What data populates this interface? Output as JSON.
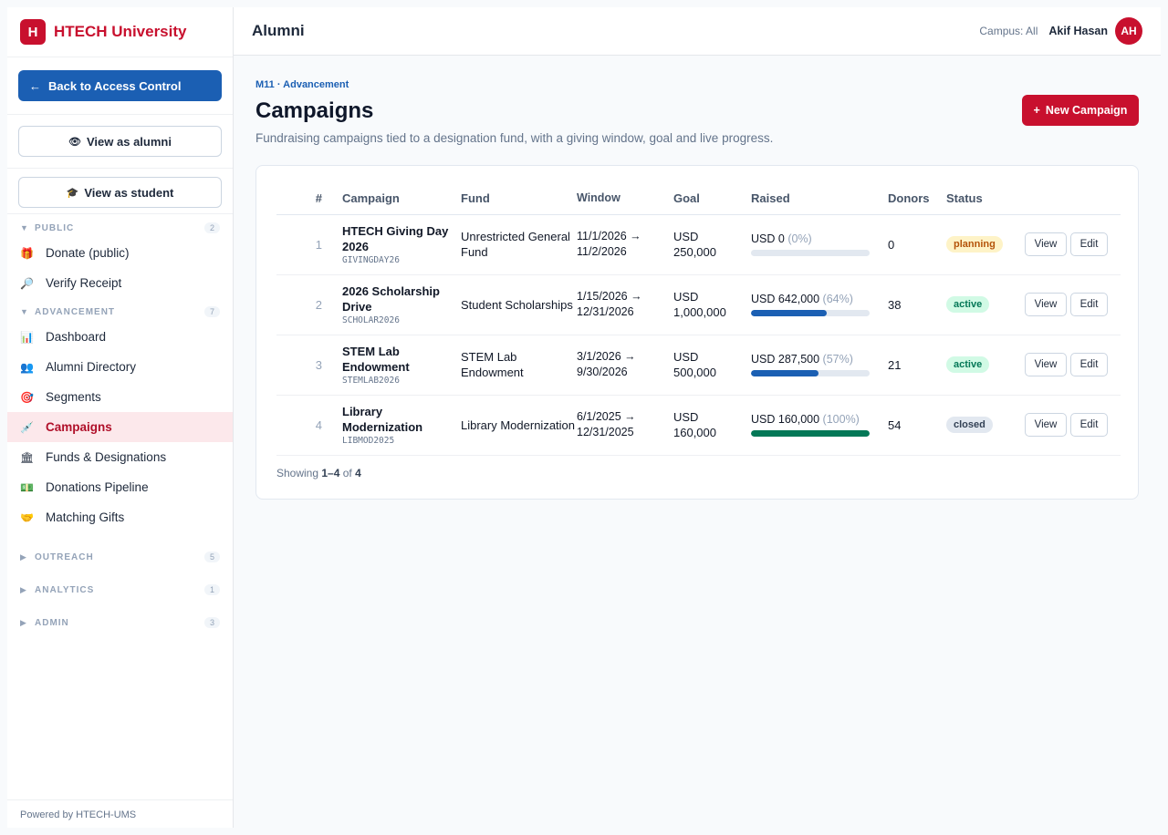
{
  "brand": {
    "logo_letter": "H",
    "name": "HTECH University"
  },
  "sidebar": {
    "back_button": "Back to Access Control",
    "view_alumni": "View as alumni",
    "view_student": "View as student",
    "sections": [
      {
        "title": "PUBLIC",
        "count": "2",
        "expanded": true,
        "items": [
          {
            "label": "Donate (public)",
            "icon": "gift-icon"
          },
          {
            "label": "Verify Receipt",
            "icon": "magnifier-icon"
          }
        ]
      },
      {
        "title": "ADVANCEMENT",
        "count": "7",
        "expanded": true,
        "items": [
          {
            "label": "Dashboard",
            "icon": "chart-icon"
          },
          {
            "label": "Alumni Directory",
            "icon": "people-icon"
          },
          {
            "label": "Segments",
            "icon": "target-icon"
          },
          {
            "label": "Campaigns",
            "icon": "syringe-icon",
            "active": true
          },
          {
            "label": "Funds & Designations",
            "icon": "bank-icon"
          },
          {
            "label": "Donations Pipeline",
            "icon": "money-icon"
          },
          {
            "label": "Matching Gifts",
            "icon": "handshake-icon"
          }
        ]
      },
      {
        "title": "OUTREACH",
        "count": "5",
        "expanded": false
      },
      {
        "title": "ANALYTICS",
        "count": "1",
        "expanded": false
      },
      {
        "title": "ADMIN",
        "count": "3",
        "expanded": false
      }
    ],
    "powered_by": "Powered by HTECH-UMS"
  },
  "header": {
    "title": "Alumni",
    "campus": "Campus: All",
    "user": "Akif Hasan",
    "avatar": "AH"
  },
  "main": {
    "module": "M11 · Advancement",
    "title": "Campaigns",
    "subtitle": "Fundraising campaigns tied to a designation fund, with a giving window, goal and live progress.",
    "new_button": "New Campaign",
    "columns": [
      "#",
      "Campaign",
      "Fund",
      "Window",
      "Goal",
      "Raised",
      "Donors",
      "Status"
    ],
    "rows": [
      {
        "num": "1",
        "name": "HTECH Giving Day 2026",
        "code": "GIVINGDAY26",
        "fund": "Unrestricted General Fund",
        "window_start": "11/1/2026 →",
        "window_end": "11/2/2026",
        "goal_cur": "USD",
        "goal_amt": "250,000",
        "raised": "USD 0",
        "pct": "(0%)",
        "progress": 0,
        "progress_color": "#1b5fb3",
        "donors": "0",
        "status": "planning",
        "status_bg": "#fef3c7",
        "status_fg": "#b45309"
      },
      {
        "num": "2",
        "name": "2026 Scholarship Drive",
        "code": "SCHOLAR2026",
        "fund": "Student Scholarships",
        "window_start": "1/15/2026 →",
        "window_end": "12/31/2026",
        "goal_cur": "USD",
        "goal_amt": "1,000,000",
        "raised": "USD 642,000",
        "pct": "(64%)",
        "progress": 0.64,
        "progress_color": "#1b5fb3",
        "donors": "38",
        "status": "active",
        "status_bg": "#d1fae5",
        "status_fg": "#047857"
      },
      {
        "num": "3",
        "name": "STEM Lab Endowment",
        "code": "STEMLAB2026",
        "fund": "STEM Lab Endowment",
        "window_start": "3/1/2026 →",
        "window_end": "9/30/2026",
        "goal_cur": "USD",
        "goal_amt": "500,000",
        "raised": "USD 287,500",
        "pct": "(57%)",
        "progress": 0.57,
        "progress_color": "#1b5fb3",
        "donors": "21",
        "status": "active",
        "status_bg": "#d1fae5",
        "status_fg": "#047857"
      },
      {
        "num": "4",
        "name": "Library Modernization",
        "code": "LIBMOD2025",
        "fund": "Library Modernization",
        "window_start": "6/1/2025 →",
        "window_end": "12/31/2025",
        "goal_cur": "USD",
        "goal_amt": "160,000",
        "raised": "USD 160,000",
        "pct": "(100%)",
        "progress": 1.0,
        "progress_color": "#047857",
        "donors": "54",
        "status": "closed",
        "status_bg": "#e2e8f0",
        "status_fg": "#334155"
      }
    ],
    "view_label": "View",
    "edit_label": "Edit",
    "showing_prefix": "Showing",
    "showing_range": "1–4",
    "showing_of": "of",
    "showing_total": "4"
  }
}
